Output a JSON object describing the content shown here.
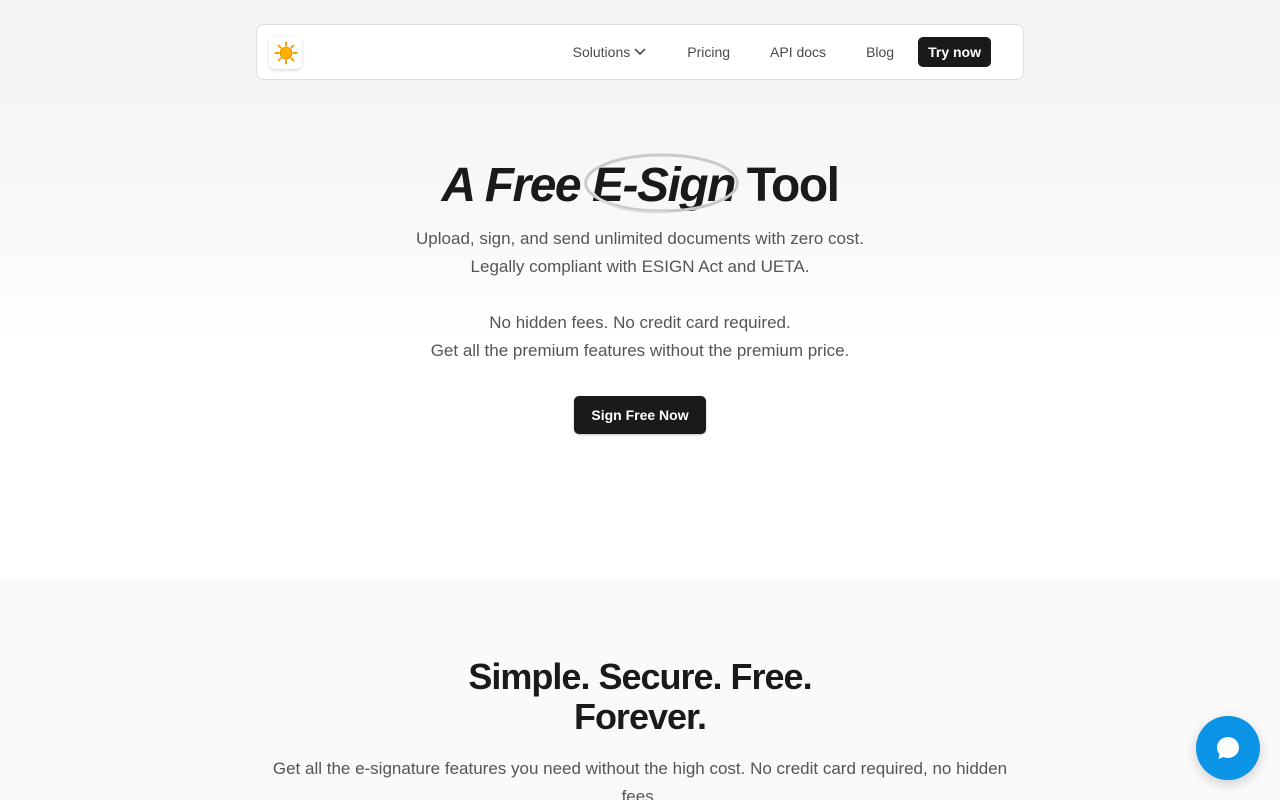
{
  "nav": {
    "logo_icon": "sun-icon",
    "links": [
      "Solutions",
      "Pricing",
      "API docs",
      "Blog"
    ],
    "cta": "Try now"
  },
  "hero": {
    "title_part1": "A Free ",
    "title_highlight": "E-Sign",
    "title_part2": " Tool",
    "lines": [
      "Upload, sign, and send unlimited documents with zero cost.",
      "Legally compliant with ESIGN Act and UETA.",
      "No hidden fees. No credit card required.",
      "Get all the premium features without the premium price."
    ],
    "cta": "Sign Free Now"
  },
  "features": {
    "title_line1": "Simple. Secure. Free.",
    "title_line2": "Forever.",
    "subtitle": "Get all the e-signature features you need without the high cost. No credit card required, no hidden fees."
  },
  "chat": {
    "icon": "chat-bubble-icon"
  },
  "colors": {
    "accent": "#0b93e6",
    "dark": "#1a1a1a",
    "muted": "#555555"
  }
}
